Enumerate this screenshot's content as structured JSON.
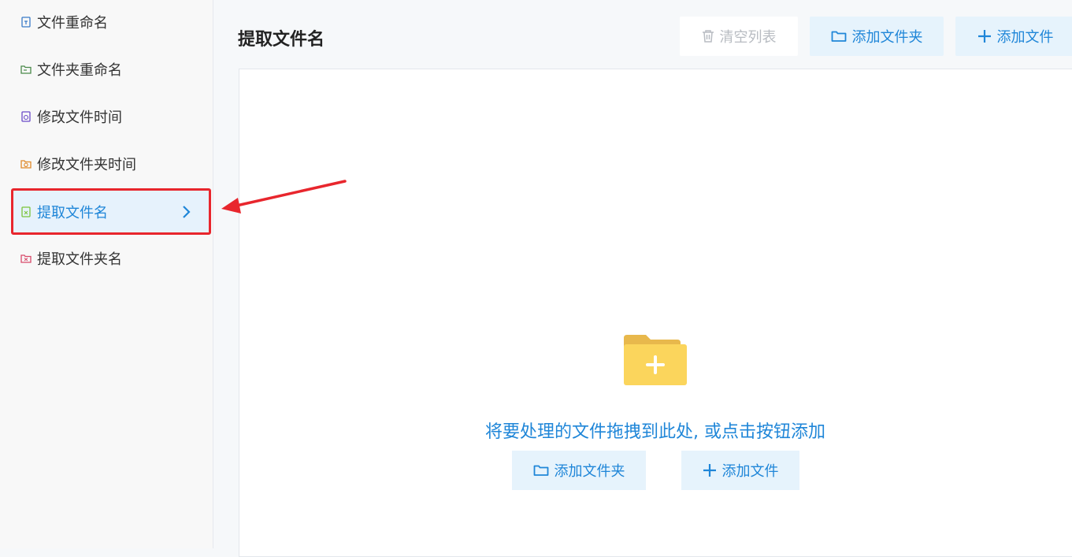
{
  "sidebar": {
    "items": [
      {
        "label": "文件重命名",
        "color": "#3a7bc8",
        "active": false
      },
      {
        "label": "文件夹重命名",
        "color": "#4a8a4a",
        "active": false
      },
      {
        "label": "修改文件时间",
        "color": "#6a4ac8",
        "active": false
      },
      {
        "label": "修改文件夹时间",
        "color": "#e0892a",
        "active": false
      },
      {
        "label": "提取文件名",
        "color": "#7ac43a",
        "active": true
      },
      {
        "label": "提取文件夹名",
        "color": "#d84a6a",
        "active": false
      }
    ]
  },
  "main": {
    "title": "提取文件名",
    "toolbar": {
      "clear_label": "清空列表",
      "add_folder_label": "添加文件夹",
      "add_file_label": "添加文件"
    },
    "dropzone": {
      "hint": "将要处理的文件拖拽到此处, 或点击按钮添加",
      "add_folder_label": "添加文件夹",
      "add_file_label": "添加文件"
    }
  },
  "colors": {
    "accent": "#1f86d8",
    "highlight": "#e8262d",
    "folder": "#fbd55c"
  }
}
